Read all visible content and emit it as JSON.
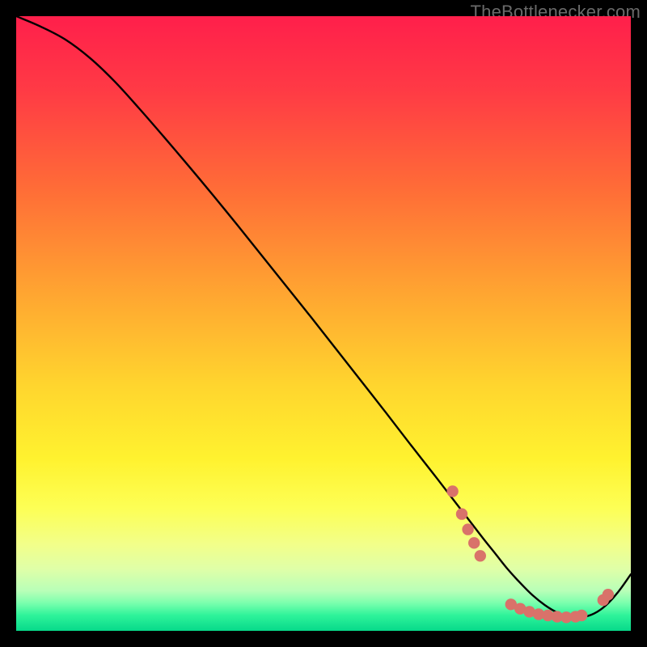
{
  "watermark": "TheBottlenecker.com",
  "colors": {
    "bg": "#000000",
    "curve": "#000000",
    "marker_fill": "#d9726a",
    "marker_stroke": "#c85e56",
    "gradient_stops": [
      {
        "offset": 0.0,
        "color": "#ff1f4b"
      },
      {
        "offset": 0.12,
        "color": "#ff3a45"
      },
      {
        "offset": 0.28,
        "color": "#ff6c37"
      },
      {
        "offset": 0.45,
        "color": "#ffa531"
      },
      {
        "offset": 0.6,
        "color": "#ffd52e"
      },
      {
        "offset": 0.72,
        "color": "#fff22f"
      },
      {
        "offset": 0.8,
        "color": "#fdff55"
      },
      {
        "offset": 0.86,
        "color": "#f2ff8a"
      },
      {
        "offset": 0.9,
        "color": "#dfffa8"
      },
      {
        "offset": 0.935,
        "color": "#b8ffb8"
      },
      {
        "offset": 0.955,
        "color": "#7affad"
      },
      {
        "offset": 0.975,
        "color": "#2ef39a"
      },
      {
        "offset": 1.0,
        "color": "#07d98a"
      }
    ]
  },
  "chart_data": {
    "type": "line",
    "title": "",
    "xlabel": "",
    "ylabel": "",
    "xlim": [
      0,
      100
    ],
    "ylim": [
      0,
      100
    ],
    "grid": false,
    "legend": false,
    "series": [
      {
        "name": "bottleneck-curve",
        "x": [
          0,
          4,
          8,
          12,
          16,
          20,
          24,
          28,
          32,
          36,
          40,
          44,
          48,
          52,
          56,
          60,
          64,
          68,
          72,
          74,
          76,
          78,
          80,
          82,
          84,
          86,
          88,
          90,
          92,
          94,
          96,
          98,
          100
        ],
        "y": [
          100,
          98.3,
          96.2,
          93.2,
          89.4,
          85.0,
          80.4,
          75.7,
          70.9,
          66.0,
          61.0,
          56.0,
          51.0,
          45.9,
          40.8,
          35.7,
          30.5,
          25.4,
          20.2,
          17.6,
          15.0,
          12.5,
          10.0,
          7.8,
          5.8,
          4.2,
          3.0,
          2.3,
          2.2,
          2.8,
          4.2,
          6.4,
          9.2
        ]
      }
    ],
    "markers": [
      {
        "x": 71.0,
        "y": 22.7
      },
      {
        "x": 72.5,
        "y": 19.0
      },
      {
        "x": 73.5,
        "y": 16.5
      },
      {
        "x": 74.5,
        "y": 14.3
      },
      {
        "x": 75.5,
        "y": 12.2
      },
      {
        "x": 80.5,
        "y": 4.3
      },
      {
        "x": 82.0,
        "y": 3.6
      },
      {
        "x": 83.5,
        "y": 3.1
      },
      {
        "x": 85.0,
        "y": 2.7
      },
      {
        "x": 86.5,
        "y": 2.5
      },
      {
        "x": 88.0,
        "y": 2.3
      },
      {
        "x": 89.5,
        "y": 2.2
      },
      {
        "x": 91.0,
        "y": 2.3
      },
      {
        "x": 92.0,
        "y": 2.5
      },
      {
        "x": 95.5,
        "y": 5.0
      },
      {
        "x": 96.3,
        "y": 5.9
      }
    ]
  }
}
